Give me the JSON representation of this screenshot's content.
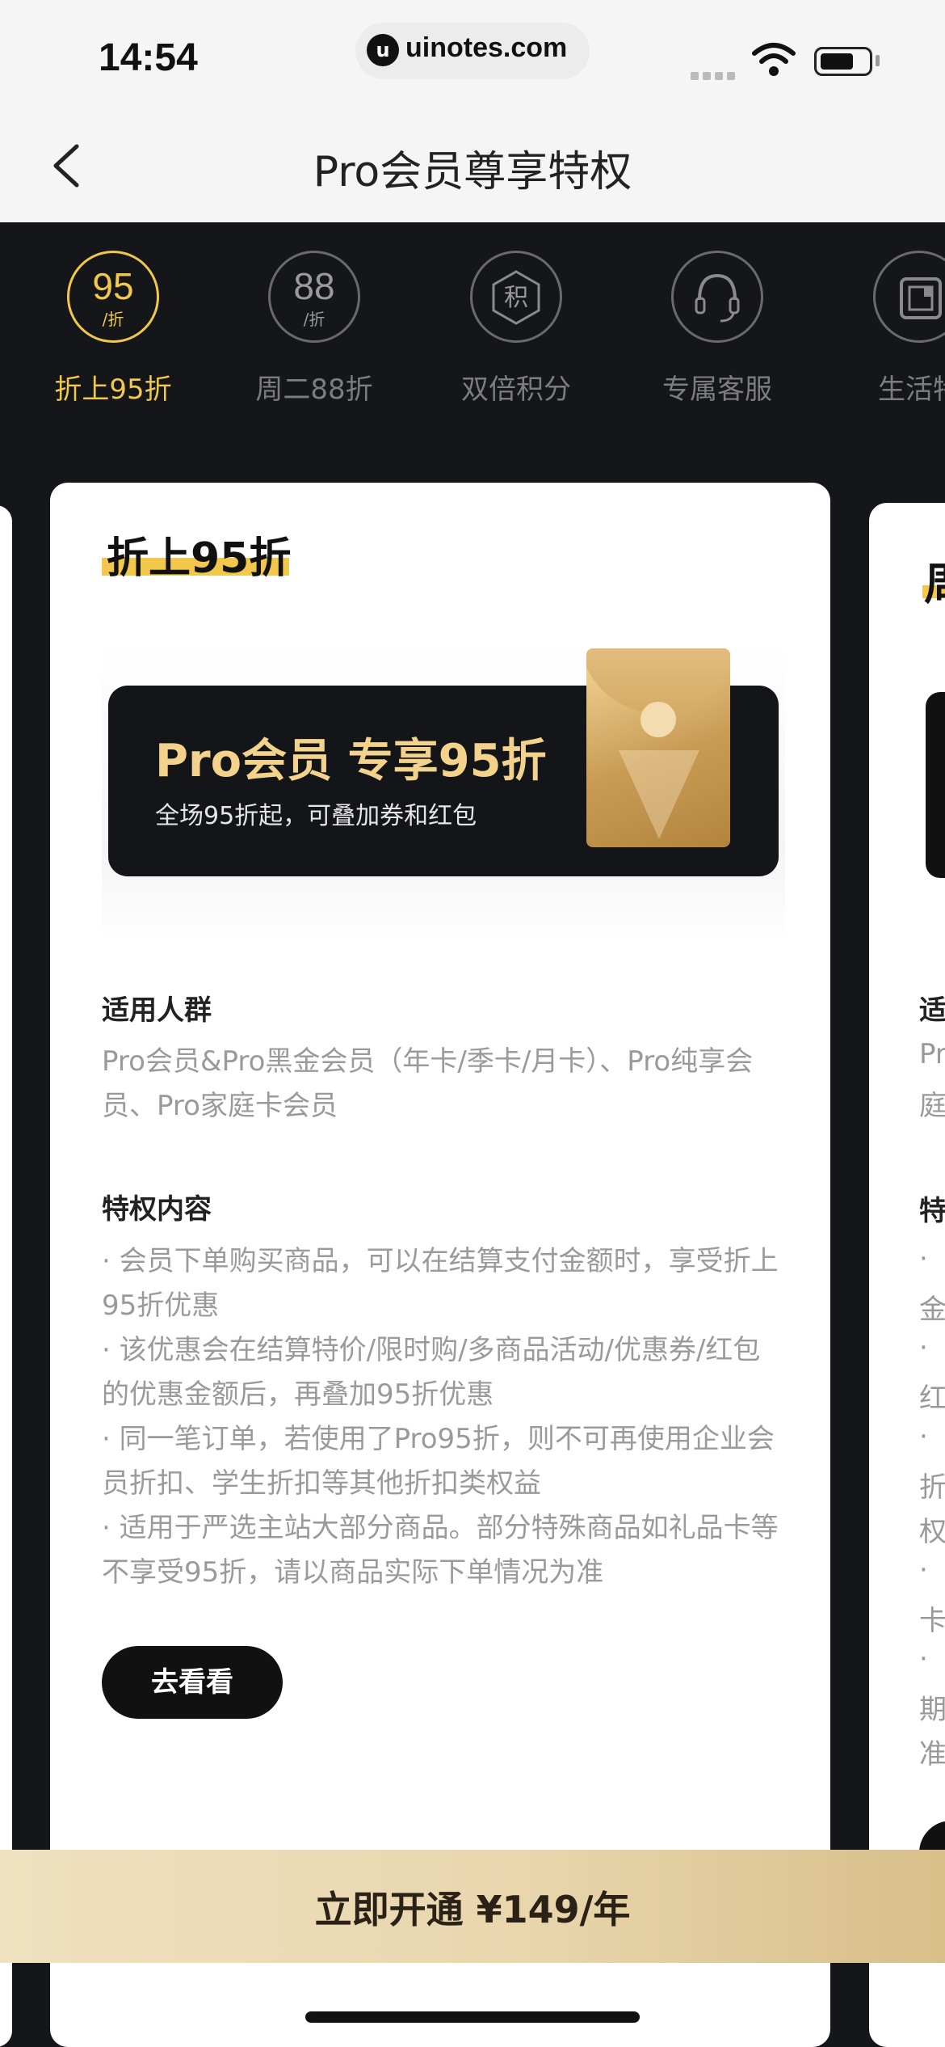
{
  "status_bar": {
    "time": "14:54",
    "url": "uinotes.com",
    "url_logo": "u"
  },
  "header": {
    "title": "Pro会员尊享特权"
  },
  "tabs": [
    {
      "num": "95",
      "sub": "/折",
      "label": "折上95折",
      "icon": "discount-95-icon"
    },
    {
      "num": "88",
      "sub": "/折",
      "label": "周二88折",
      "icon": "discount-88-icon"
    },
    {
      "num": "积",
      "sub": "",
      "label": "双倍积分",
      "icon": "points-icon"
    },
    {
      "num": "",
      "sub": "",
      "label": "专属客服",
      "icon": "headset-icon"
    },
    {
      "num": "",
      "sub": "",
      "label": "生活特",
      "icon": "life-icon"
    }
  ],
  "card": {
    "title": "折上95折",
    "banner": {
      "title": "Pro会员 专享95折",
      "subtitle": "全场95折起，可叠加券和红包"
    },
    "audience": {
      "heading": "适用人群",
      "text": "Pro会员&Pro黑金会员（年卡/季卡/月卡）、Pro纯享会员、Pro家庭卡会员"
    },
    "content": {
      "heading": "特权内容",
      "items": [
        "· 会员下单购买商品，可以在结算支付金额时，享受折上95折优惠",
        "· 该优惠会在结算特价/限时购/多商品活动/优惠券/红包的优惠金额后，再叠加95折优惠",
        "· 同一笔订单，若使用了Pro95折，则不可再使用企业会员折扣、学生折扣等其他折扣类权益",
        "· 适用于严选主站大部分商品。部分特殊商品如礼品卡等不享受95折，请以商品实际下单情况为准"
      ]
    },
    "button": "去看看"
  },
  "peek_card": {
    "title": "周",
    "heading1": "适",
    "lines1": [
      "Pr",
      "庭"
    ],
    "heading2": "特",
    "lines2": [
      "·",
      "金",
      "·",
      "红",
      "·",
      "折",
      "权",
      "·",
      "卡",
      "·",
      "期",
      "准"
    ]
  },
  "cta": {
    "label": "立即开通 ¥149/年"
  },
  "colors": {
    "accent": "#f1c84b",
    "dark": "#15161a",
    "gold": "#e9d6ad"
  }
}
